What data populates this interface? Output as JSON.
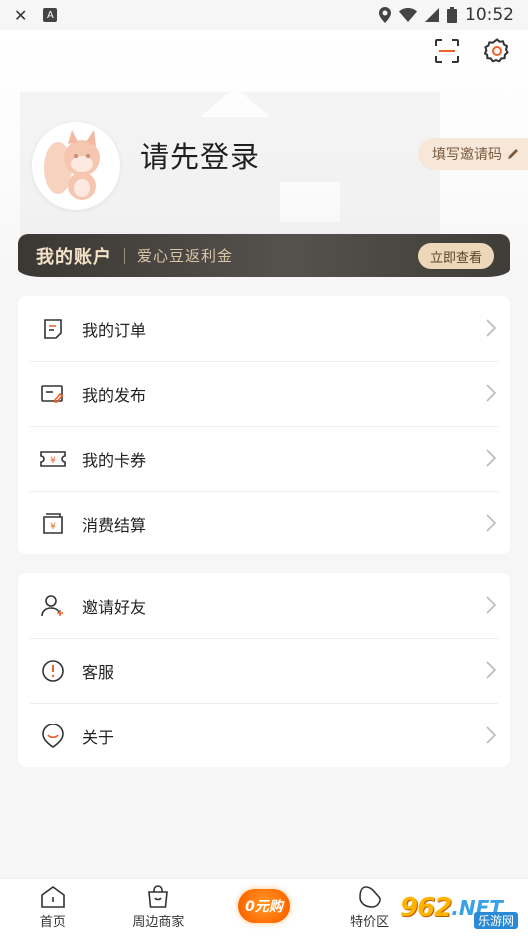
{
  "status_bar": {
    "time": "10:52",
    "left_icon_letter": "A"
  },
  "header": {
    "login_prompt": "请先登录",
    "invite_code_label": "填写邀请码"
  },
  "account_banner": {
    "title": "我的账户",
    "subtitle": "爱心豆返利金",
    "button": "立即查看"
  },
  "menu_group_1": [
    {
      "label": "我的订单",
      "icon": "order-icon"
    },
    {
      "label": "我的发布",
      "icon": "publish-icon"
    },
    {
      "label": "我的卡券",
      "icon": "coupon-icon"
    },
    {
      "label": "消费结算",
      "icon": "settlement-icon"
    }
  ],
  "menu_group_2": [
    {
      "label": "邀请好友",
      "icon": "invite-friend-icon"
    },
    {
      "label": "客服",
      "icon": "customer-service-icon"
    },
    {
      "label": "关于",
      "icon": "about-icon"
    }
  ],
  "bottom_nav": [
    {
      "label": "首页",
      "icon": "home-icon"
    },
    {
      "label": "周边商家",
      "icon": "shopping-bag-icon"
    },
    {
      "label": "0元购",
      "icon": "zero-yuan-badge"
    },
    {
      "label": "特价区",
      "icon": "bean-icon"
    }
  ],
  "watermark_logo": {
    "main": "962",
    "suffix": ".NET",
    "sub": "乐游网"
  },
  "colors": {
    "accent": "#f0622c",
    "banner_bg": "#3b3834",
    "banner_text": "#f3e2c8",
    "pill_bg": "#f6e7d8"
  }
}
